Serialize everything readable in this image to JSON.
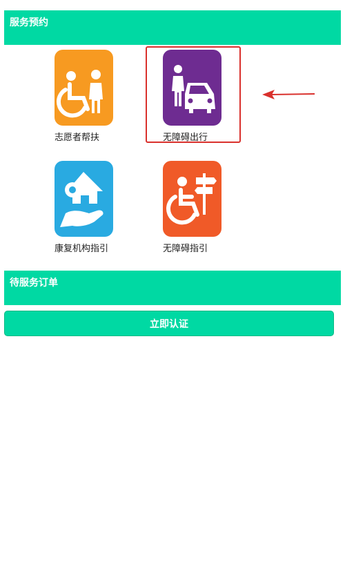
{
  "colors": {
    "accent": "#00d9a3",
    "volunteer_bg": "#f79a21",
    "barrier_free_travel_bg": "#6e2c91",
    "rehab_bg": "#29aae1",
    "accessibility_guide_bg": "#f05a28",
    "highlight": "#d9302c"
  },
  "services": {
    "header": "服务预约",
    "items": [
      {
        "label": "志愿者帮扶",
        "icon": "wheelchair-helper-icon"
      },
      {
        "label": "无障碍出行",
        "icon": "person-car-icon"
      },
      {
        "label": "康复机构指引",
        "icon": "hand-house-icon"
      },
      {
        "label": "无障碍指引",
        "icon": "wheelchair-signpost-icon"
      }
    ]
  },
  "pending_orders": {
    "header": "待服务订单"
  },
  "verify_button": {
    "label": "立即认证"
  }
}
